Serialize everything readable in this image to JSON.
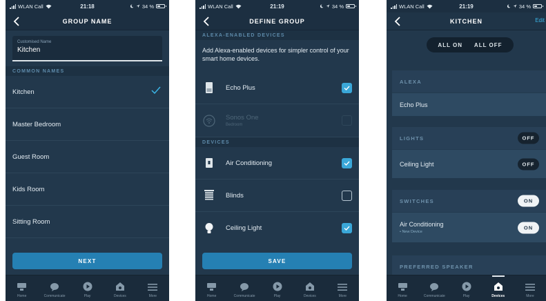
{
  "status": {
    "carrier": "WLAN Call",
    "battery": "34 %",
    "s1_time": "21:18",
    "s2_time": "21:19",
    "s3_time": "21:19"
  },
  "nav": {
    "home": "Home",
    "communicate": "Communicate",
    "play": "Play",
    "devices": "Devices",
    "more": "More"
  },
  "screen1": {
    "title": "GROUP NAME",
    "field_label": "Customised Name",
    "field_value": "Kitchen",
    "section": "COMMON NAMES",
    "names": [
      "Kitchen",
      "Master Bedroom",
      "Guest Room",
      "Kids Room",
      "Sitting Room"
    ],
    "selected": "Kitchen",
    "next_label": "NEXT"
  },
  "screen2": {
    "title": "DEFINE GROUP",
    "alexa_section": "ALEXA-ENABLED DEVICES",
    "description": "Add Alexa-enabled devices for simpler control of your smart home devices.",
    "alexa_devices": [
      {
        "name": "Echo Plus",
        "sub": "",
        "checked": true,
        "enabled": true,
        "icon": "echo-plus-icon"
      },
      {
        "name": "Sonos One",
        "sub": "Bedroom",
        "checked": false,
        "enabled": false,
        "icon": "wifi-speaker-icon"
      }
    ],
    "devices_section": "DEVICES",
    "devices": [
      {
        "name": "Air Conditioning",
        "checked": true,
        "icon": "plug-icon"
      },
      {
        "name": "Blinds",
        "checked": false,
        "icon": "blinds-icon"
      },
      {
        "name": "Ceiling Light",
        "checked": true,
        "icon": "bulb-icon"
      }
    ],
    "save_label": "SAVE"
  },
  "screen3": {
    "title": "KITCHEN",
    "edit_label": "Edit",
    "all_on": "ALL ON",
    "all_off": "ALL OFF",
    "alexa_header": "ALEXA",
    "alexa_device": "Echo Plus",
    "lights_header": "LIGHTS",
    "lights_toggle": "OFF",
    "light_name": "Ceiling Light",
    "light_toggle": "OFF",
    "switches_header": "SWITCHES",
    "switches_toggle": "ON",
    "switch_name": "Air Conditioning",
    "switch_sub": "• New Device",
    "switch_toggle": "ON",
    "speaker_header": "PREFERRED SPEAKER"
  },
  "colors": {
    "background": "#22384c",
    "accent": "#3aa7d8",
    "button": "#2580b3"
  }
}
